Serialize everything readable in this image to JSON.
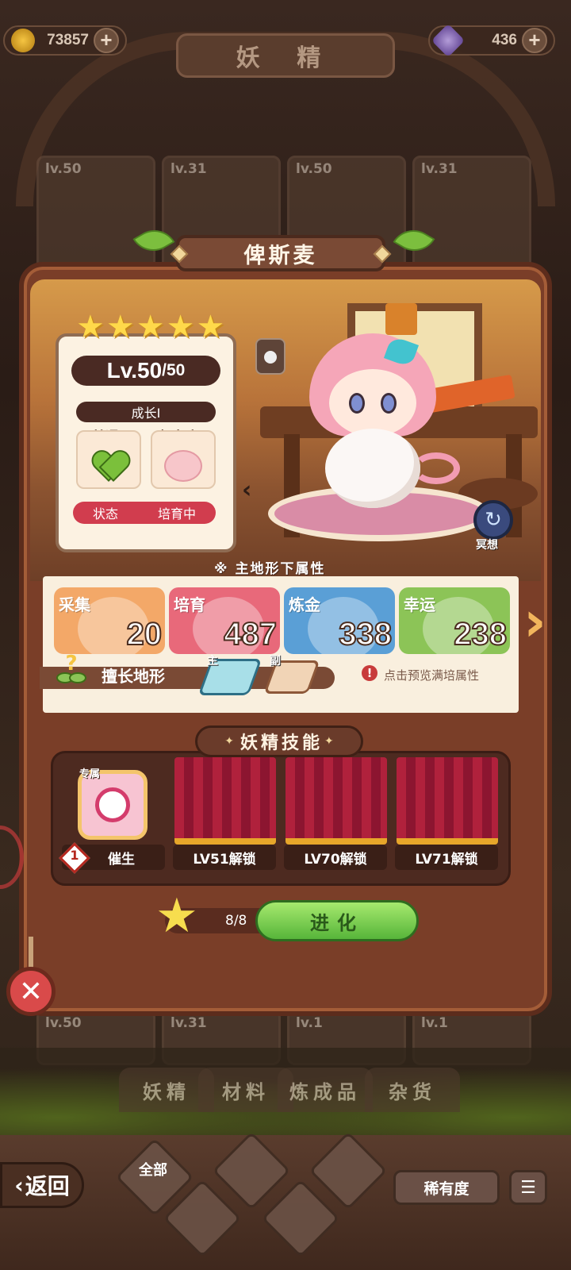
{
  "header": {
    "coins": "73857",
    "gems": "436",
    "title": "妖 精"
  },
  "background_cards": [
    {
      "level": "lv.50"
    },
    {
      "level": "lv.31"
    },
    {
      "level": "lv.50"
    },
    {
      "level": "lv.31"
    }
  ],
  "background_cards_lower": [
    {
      "level": "lv.50"
    },
    {
      "level": "lv.31"
    },
    {
      "level": "lv.1"
    },
    {
      "level": "lv.1"
    }
  ],
  "fairy": {
    "name": "俾斯麦",
    "stars": 5,
    "level_current": "Lv.50",
    "level_max": "/50",
    "growth": "成长I",
    "mood_label": "普通",
    "effort_label": "努力度",
    "status_label": "状态",
    "status_value": "培育中",
    "meditate_label": "冥想"
  },
  "attributes": {
    "heading": "※ 主地形下属性",
    "items": [
      {
        "label": "采集",
        "value": "20",
        "color": "#f3a868"
      },
      {
        "label": "培育",
        "value": "487",
        "color": "#e8697a"
      },
      {
        "label": "炼金",
        "value": "338",
        "color": "#5a9fd6"
      },
      {
        "label": "幸运",
        "value": "238",
        "color": "#8cc457"
      }
    ],
    "terrain_label": "擅长地形",
    "terrain_main_tag": "主",
    "terrain_sub_tag": "副",
    "hint": "点击预览满培属性"
  },
  "skills": {
    "title": "妖精技能",
    "exclusive_tag": "专属",
    "slots": [
      {
        "caption": "催生",
        "level": "1",
        "unlocked": true
      },
      {
        "caption": "LV51解锁",
        "unlocked": false
      },
      {
        "caption": "LV70解锁",
        "unlocked": false
      },
      {
        "caption": "LV71解锁",
        "unlocked": false
      }
    ]
  },
  "evolve": {
    "count": "8/8",
    "button_label": "进化"
  },
  "bottom_tabs": [
    "妖精",
    "材料",
    "炼成品",
    "杂货"
  ],
  "footer": {
    "back_label": "返回",
    "filter_all": "全部",
    "rarity_label": "稀有度"
  }
}
